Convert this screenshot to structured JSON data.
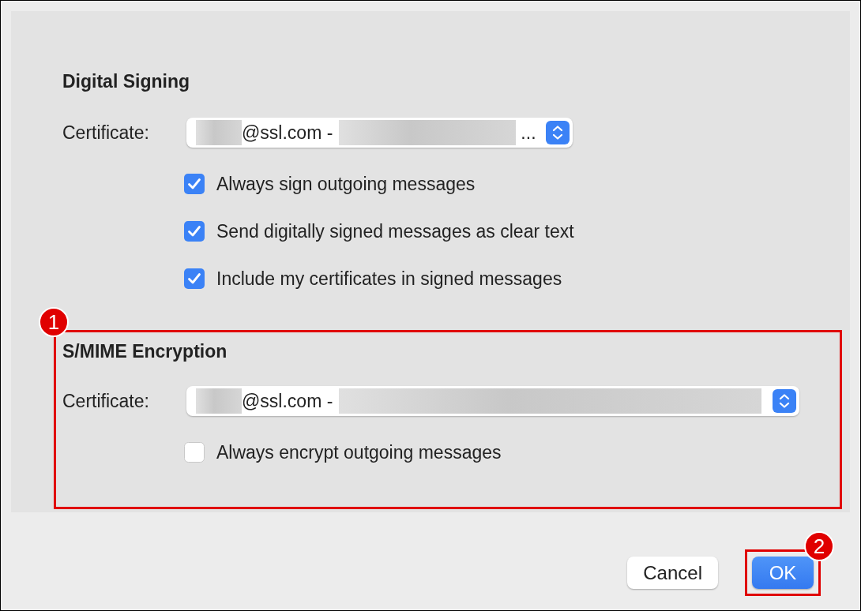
{
  "sections": [
    {
      "title": "Digital Signing",
      "certificate": {
        "label": "Certificate:",
        "value": "@ssl.com -",
        "truncation": "..."
      },
      "options": [
        {
          "label": "Always sign outgoing messages",
          "checked": true
        },
        {
          "label": "Send digitally signed messages as clear text",
          "checked": true
        },
        {
          "label": "Include my certificates in signed messages",
          "checked": true
        }
      ]
    },
    {
      "title": "S/MIME Encryption",
      "callout": "1",
      "certificate": {
        "label": "Certificate:",
        "value": "@ssl.com -"
      },
      "options": [
        {
          "label": "Always encrypt outgoing messages",
          "checked": false
        }
      ]
    }
  ],
  "buttons": [
    {
      "label": "Cancel",
      "default": false
    },
    {
      "label": "OK",
      "default": true,
      "callout": "2"
    }
  ]
}
